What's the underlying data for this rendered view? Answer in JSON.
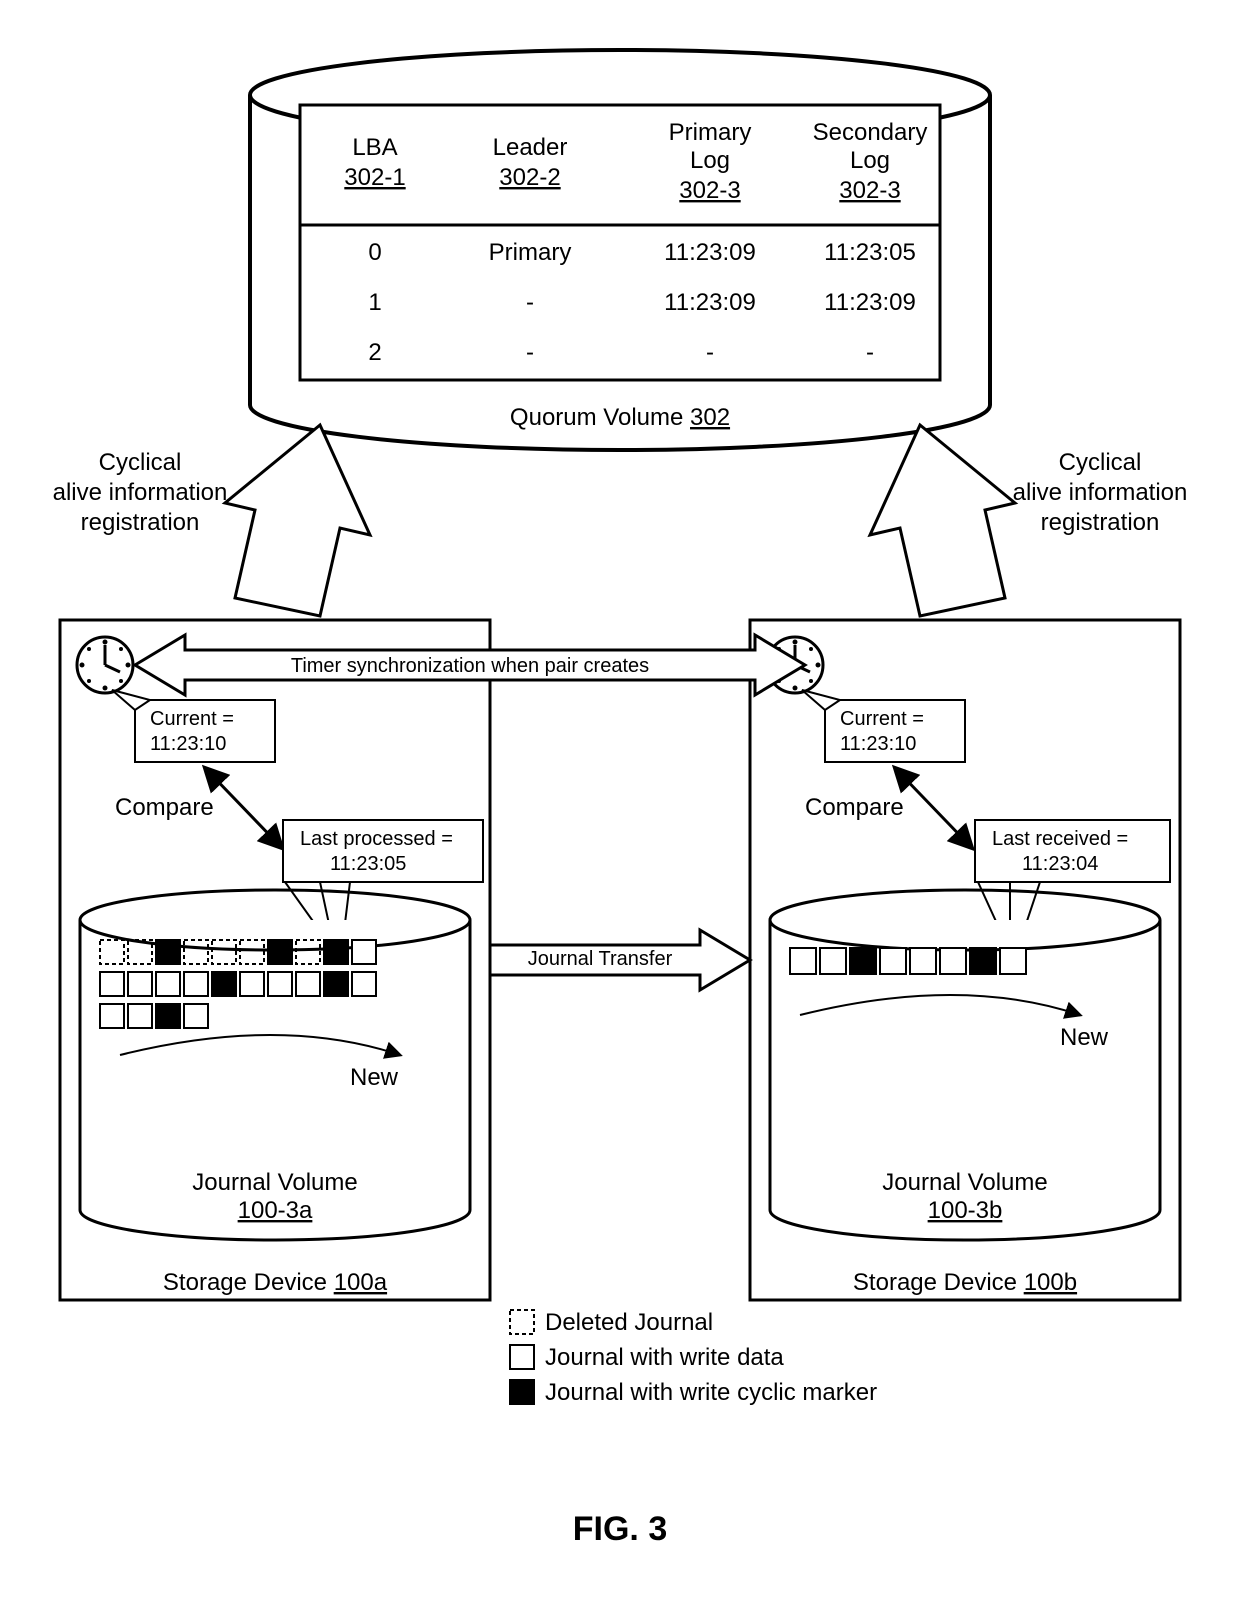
{
  "figure_label": "FIG. 3",
  "quorum": {
    "title": "Quorum Volume",
    "ref": "302",
    "headers": {
      "c1": "LBA",
      "c1ref": "302-1",
      "c2": "Leader",
      "c2ref": "302-2",
      "c3": "Primary",
      "c3b": "Log",
      "c3ref": "302-3",
      "c4": "Secondary",
      "c4b": "Log",
      "c4ref": "302-3"
    },
    "rows": [
      {
        "lba": "0",
        "leader": "Primary",
        "p": "11:23:09",
        "s": "11:23:05"
      },
      {
        "lba": "1",
        "leader": "-",
        "p": "11:23:09",
        "s": "11:23:09"
      },
      {
        "lba": "2",
        "leader": "-",
        "p": "-",
        "s": "-"
      }
    ]
  },
  "annot": {
    "cyclical_l1": "Cyclical",
    "cyclical_l2": "alive information",
    "cyclical_l3": "registration",
    "timer_sync": "Timer synchronization when pair creates",
    "journal_transfer": "Journal Transfer",
    "compare": "Compare",
    "new": "New"
  },
  "left": {
    "device_label": "Storage Device",
    "device_ref": "100a",
    "current_label": "Current =",
    "current_val": "11:23:10",
    "last_label": "Last processed =",
    "last_val": "11:23:05",
    "jv_label": "Journal Volume",
    "jv_ref": "100-3a"
  },
  "right": {
    "device_label": "Storage Device",
    "device_ref": "100b",
    "current_label": "Current =",
    "current_val": "11:23:10",
    "last_label": "Last received =",
    "last_val": "11:23:04",
    "jv_label": "Journal Volume",
    "jv_ref": "100-3b"
  },
  "legend": {
    "deleted": "Deleted Journal",
    "write": "Journal with write data",
    "cyclic": "Journal with write cyclic marker"
  }
}
